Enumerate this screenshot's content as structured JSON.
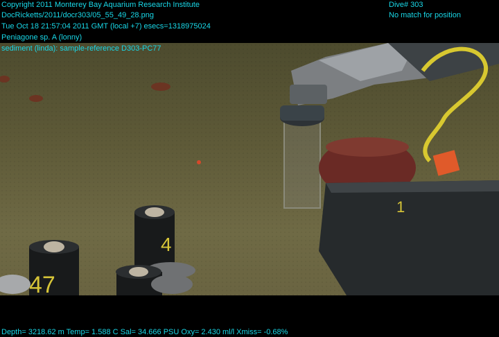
{
  "header": {
    "line1": "Copyright 2011 Monterey Bay Aquarium Research Institute",
    "line2": "DocRicketts/2011/docr303/05_55_49_28.png",
    "line3": "Tue Oct 18 21:57:04 2011 GMT (local +7)  esecs=1318975024",
    "line4": "Peniagone sp. A (lonny)",
    "line5": "sediment (linda): sample-reference D303-PC77"
  },
  "dive": {
    "number": "Dive# 303",
    "position_status": "No match for position"
  },
  "footer": {
    "telemetry": "Depth= 3218.62 m  Temp= 1.588 C  Sal= 34.666 PSU  Oxy= 2.430 ml/l  Xmiss= -0.68%"
  },
  "scene": {
    "core_labels": [
      "4",
      "47",
      "1"
    ]
  },
  "colors": {
    "overlay_text": "#19d8e8",
    "seafloor": "#5e5a38"
  }
}
